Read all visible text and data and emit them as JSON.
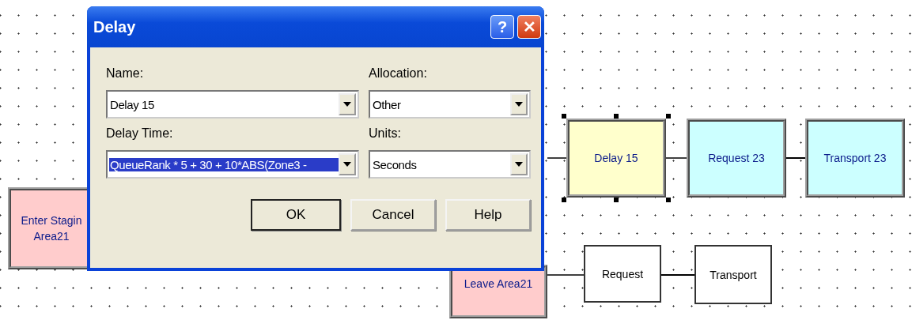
{
  "canvas": {
    "nodes": [
      {
        "lines": [
          "Delay 15"
        ],
        "color": "#ffffcc",
        "selected": true,
        "outlined": false
      },
      {
        "lines": [
          "Request 23"
        ],
        "color": "#ccffff",
        "selected": false,
        "outlined": false
      },
      {
        "lines": [
          "Transport 23"
        ],
        "color": "#ccffff",
        "selected": false,
        "outlined": false
      },
      {
        "lines": [
          "Request"
        ],
        "color": "#ffffff",
        "selected": false,
        "outlined": true
      },
      {
        "lines": [
          "Transport"
        ],
        "color": "#ffffff",
        "selected": false,
        "outlined": true
      },
      {
        "lines": [
          "Leave Area21"
        ],
        "color": "#ffcccc",
        "selected": false,
        "outlined": false
      },
      {
        "lines": [
          "Enter Stagin",
          "Area21"
        ],
        "color": "#ffcccc",
        "selected": false,
        "outlined": false
      }
    ]
  },
  "dialog": {
    "title": "Delay",
    "help_button": "?",
    "close_button": "✕",
    "fields": [
      {
        "label": "Name:",
        "value": "Delay 15",
        "selected": false
      },
      {
        "label": "Allocation:",
        "value": "Other",
        "selected": false
      },
      {
        "label": "Delay Time:",
        "value": "QueueRank * 5 + 30 + 10*ABS(Zone3 -",
        "selected": true
      },
      {
        "label": "Units:",
        "value": "Seconds",
        "selected": false
      }
    ],
    "buttons": [
      {
        "label": "OK",
        "default": true
      },
      {
        "label": "Cancel",
        "default": false
      },
      {
        "label": "Help",
        "default": false
      }
    ]
  }
}
